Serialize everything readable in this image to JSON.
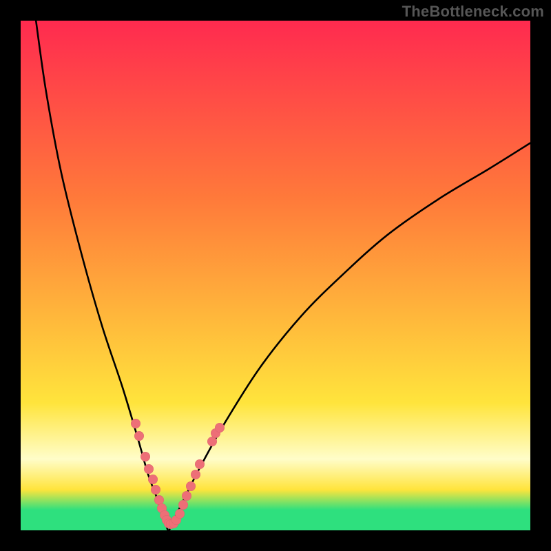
{
  "attribution": "TheBottleneck.com",
  "colors": {
    "top": "#FF2A4F",
    "mid1": "#FF7A3A",
    "mid2": "#FFE43C",
    "band_pale": "#FFFDC9",
    "green": "#2EE07E",
    "curve": "#000000",
    "dot": "#ED6F77"
  },
  "chart_data": {
    "type": "line",
    "title": "",
    "subtitle": "",
    "xlabel": "",
    "ylabel": "",
    "xlim": [
      0,
      100
    ],
    "ylim": [
      0,
      100
    ],
    "grid": false,
    "legend": false,
    "series": [
      {
        "name": "left-branch",
        "x": [
          3,
          5,
          8,
          12,
          16,
          20,
          23,
          25,
          26.5,
          27.5,
          28.3,
          29
        ],
        "y": [
          100,
          86,
          70,
          54,
          40,
          28,
          18,
          11,
          7,
          4,
          2,
          0
        ]
      },
      {
        "name": "right-branch",
        "x": [
          29,
          30,
          32,
          35,
          40,
          47,
          55,
          63,
          72,
          82,
          92,
          100
        ],
        "y": [
          0,
          2,
          6,
          12,
          21,
          32,
          42,
          50,
          58,
          65,
          71,
          76
        ]
      }
    ],
    "points": [
      {
        "name": "left-cluster",
        "x": 22.5,
        "y": 21
      },
      {
        "name": "left-cluster",
        "x": 23.3,
        "y": 18.5
      },
      {
        "name": "left-cluster",
        "x": 24.5,
        "y": 14.5
      },
      {
        "name": "left-cluster",
        "x": 25.2,
        "y": 12
      },
      {
        "name": "left-cluster",
        "x": 25.9,
        "y": 10
      },
      {
        "name": "left-cluster",
        "x": 26.5,
        "y": 8
      },
      {
        "name": "left-cluster",
        "x": 27.1,
        "y": 6
      },
      {
        "name": "left-cluster",
        "x": 27.7,
        "y": 4.3
      },
      {
        "name": "left-cluster",
        "x": 28.2,
        "y": 3
      },
      {
        "name": "left-cluster",
        "x": 28.6,
        "y": 2
      },
      {
        "name": "valley-floor",
        "x": 29,
        "y": 1.3
      },
      {
        "name": "valley-floor",
        "x": 29.5,
        "y": 1.2
      },
      {
        "name": "valley-floor",
        "x": 30,
        "y": 1.3
      },
      {
        "name": "valley-floor",
        "x": 30.6,
        "y": 2
      },
      {
        "name": "right-cluster",
        "x": 31.2,
        "y": 3.3
      },
      {
        "name": "right-cluster",
        "x": 31.9,
        "y": 5
      },
      {
        "name": "right-cluster",
        "x": 32.6,
        "y": 6.7
      },
      {
        "name": "right-cluster",
        "x": 33.4,
        "y": 8.7
      },
      {
        "name": "right-cluster",
        "x": 34.3,
        "y": 11
      },
      {
        "name": "right-cluster",
        "x": 35.2,
        "y": 13
      },
      {
        "name": "right-cluster",
        "x": 37.5,
        "y": 17.5
      },
      {
        "name": "right-cluster",
        "x": 38.3,
        "y": 19
      },
      {
        "name": "right-cluster",
        "x": 39,
        "y": 20.2
      }
    ],
    "gradient_stops": [
      {
        "pos": 0,
        "color": "top"
      },
      {
        "pos": 35,
        "color": "mid1"
      },
      {
        "pos": 75,
        "color": "mid2"
      },
      {
        "pos": 86,
        "color": "band_pale"
      },
      {
        "pos": 92,
        "color": "mid2"
      },
      {
        "pos": 96,
        "color": "green"
      },
      {
        "pos": 100,
        "color": "green"
      }
    ]
  }
}
